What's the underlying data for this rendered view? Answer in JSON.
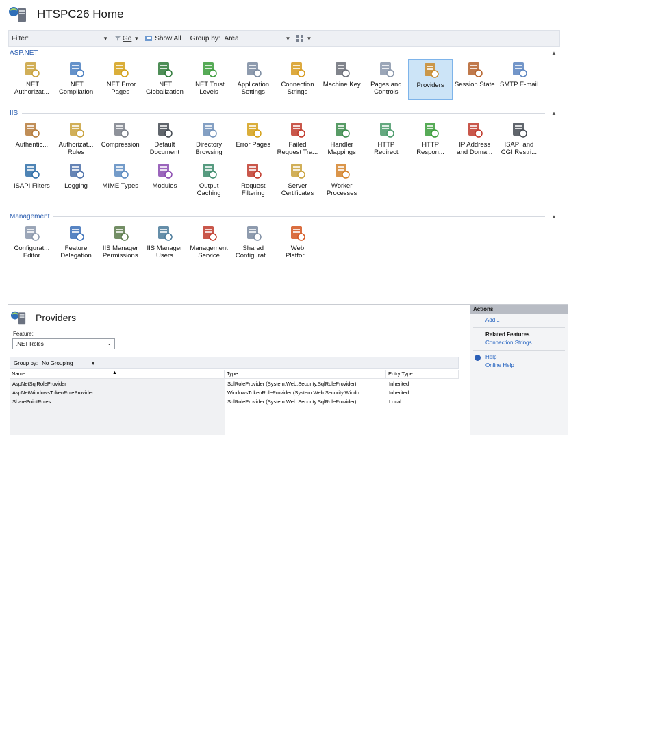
{
  "home": {
    "title": "HTSPC26 Home",
    "filter_label": "Filter:",
    "go_label": "Go",
    "show_all_label": "Show All",
    "group_by_label": "Group by:",
    "group_by_value": "Area",
    "sections": [
      {
        "name": "ASP.NET",
        "items": [
          {
            "label": ".NET\nAuthorizat...",
            "icon": "net-authorization-icon",
            "color": "#c9a13b"
          },
          {
            "label": ".NET\nCompilation",
            "icon": "net-compilation-icon",
            "color": "#4a7fc1"
          },
          {
            "label": ".NET Error\nPages",
            "icon": "net-error-pages-icon",
            "color": "#d4a017"
          },
          {
            "label": ".NET\nGlobalization",
            "icon": "net-globalization-icon",
            "color": "#2f7a3a"
          },
          {
            "label": ".NET Trust\nLevels",
            "icon": "net-trust-levels-icon",
            "color": "#3a9c3a"
          },
          {
            "label": "Application\nSettings",
            "icon": "application-settings-icon",
            "color": "#7a8aa0"
          },
          {
            "label": "Connection\nStrings",
            "icon": "connection-strings-icon",
            "color": "#d79b1e"
          },
          {
            "label": "Machine Key",
            "icon": "machine-key-icon",
            "color": "#6b6f78"
          },
          {
            "label": "Pages and\nControls",
            "icon": "pages-and-controls-icon",
            "color": "#8a97ab"
          },
          {
            "label": "Providers",
            "icon": "providers-icon",
            "color": "#c98a2a",
            "selected": true
          },
          {
            "label": "Session State",
            "icon": "session-state-icon",
            "color": "#b5622b"
          },
          {
            "label": "SMTP E-mail",
            "icon": "smtp-email-icon",
            "color": "#5a84c0"
          }
        ]
      },
      {
        "name": "IIS",
        "items": [
          {
            "label": "Authentic...",
            "icon": "authentication-icon",
            "color": "#b57a3a"
          },
          {
            "label": "Authorizat...\nRules",
            "icon": "authorization-rules-icon",
            "color": "#c9a13b"
          },
          {
            "label": "Compression",
            "icon": "compression-icon",
            "color": "#7a7f88"
          },
          {
            "label": "Default\nDocument",
            "icon": "default-document-icon",
            "color": "#444a52"
          },
          {
            "label": "Directory\nBrowsing",
            "icon": "directory-browsing-icon",
            "color": "#6f8fb8"
          },
          {
            "label": "Error Pages",
            "icon": "error-pages-icon",
            "color": "#d4a017"
          },
          {
            "label": "Failed\nRequest Tra...",
            "icon": "failed-request-tracing-icon",
            "color": "#c0392b"
          },
          {
            "label": "Handler\nMappings",
            "icon": "handler-mappings-icon",
            "color": "#3a8a4a"
          },
          {
            "label": "HTTP\nRedirect",
            "icon": "http-redirect-icon",
            "color": "#4a9a6a"
          },
          {
            "label": "HTTP\nRespon...",
            "icon": "http-response-headers-icon",
            "color": "#3a9c3a"
          },
          {
            "label": "IP Address\nand Doma...",
            "icon": "ip-address-domain-icon",
            "color": "#c0392b"
          },
          {
            "label": "ISAPI and\nCGI Restri...",
            "icon": "isapi-cgi-restrictions-icon",
            "color": "#444a52"
          },
          {
            "label": "ISAPI Filters",
            "icon": "isapi-filters-icon",
            "color": "#2f6fa8"
          },
          {
            "label": "Logging",
            "icon": "logging-icon",
            "color": "#4a6fa8"
          },
          {
            "label": "MIME Types",
            "icon": "mime-types-icon",
            "color": "#5a8ac0"
          },
          {
            "label": "Modules",
            "icon": "modules-icon",
            "color": "#8a4ab0"
          },
          {
            "label": "Output\nCaching",
            "icon": "output-caching-icon",
            "color": "#3a8a6a"
          },
          {
            "label": "Request\nFiltering",
            "icon": "request-filtering-icon",
            "color": "#c0392b"
          },
          {
            "label": "Server\nCertificates",
            "icon": "server-certificates-icon",
            "color": "#c9a13b"
          },
          {
            "label": "Worker\nProcesses",
            "icon": "worker-processes-icon",
            "color": "#d4822a"
          }
        ]
      },
      {
        "name": "Management",
        "items": [
          {
            "label": "Configurat...\nEditor",
            "icon": "configuration-editor-icon",
            "color": "#8a97ab"
          },
          {
            "label": "Feature\nDelegation",
            "icon": "feature-delegation-icon",
            "color": "#3a6fb8"
          },
          {
            "label": "IIS Manager\nPermissions",
            "icon": "iis-manager-permissions-icon",
            "color": "#5a7a4a"
          },
          {
            "label": "IIS Manager\nUsers",
            "icon": "iis-manager-users-icon",
            "color": "#4a7a9a"
          },
          {
            "label": "Management\nService",
            "icon": "management-service-icon",
            "color": "#c0392b"
          },
          {
            "label": "Shared\nConfigurat...",
            "icon": "shared-configuration-icon",
            "color": "#7a8aa0"
          },
          {
            "label": "Web\nPlatfor...",
            "icon": "web-platform-installer-icon",
            "color": "#d4551e"
          }
        ]
      }
    ]
  },
  "providers": {
    "title": "Providers",
    "feature_label": "Feature:",
    "feature_value": ".NET Roles",
    "group_by_label": "Group by:",
    "group_by_value": "No Grouping",
    "columns": [
      "Name",
      "Type",
      "Entry Type"
    ],
    "rows": [
      [
        "AspNetSqlRoleProvider",
        "SqlRoleProvider (System.Web.Security.SqlRoleProvider)",
        "Inherited"
      ],
      [
        "AspNetWindowsTokenRoleProvider",
        "WindowsTokenRoleProvider (System.Web.Security.Windo...",
        "Inherited"
      ],
      [
        "SharePointRoles",
        "SqlRoleProvider (System.Web.Security.SqlRoleProvider)",
        "Local"
      ]
    ]
  },
  "actions": {
    "header": "Actions",
    "add_label": "Add...",
    "related_header": "Related Features",
    "connection_strings_label": "Connection Strings",
    "help_label": "Help",
    "online_help_label": "Online Help"
  }
}
